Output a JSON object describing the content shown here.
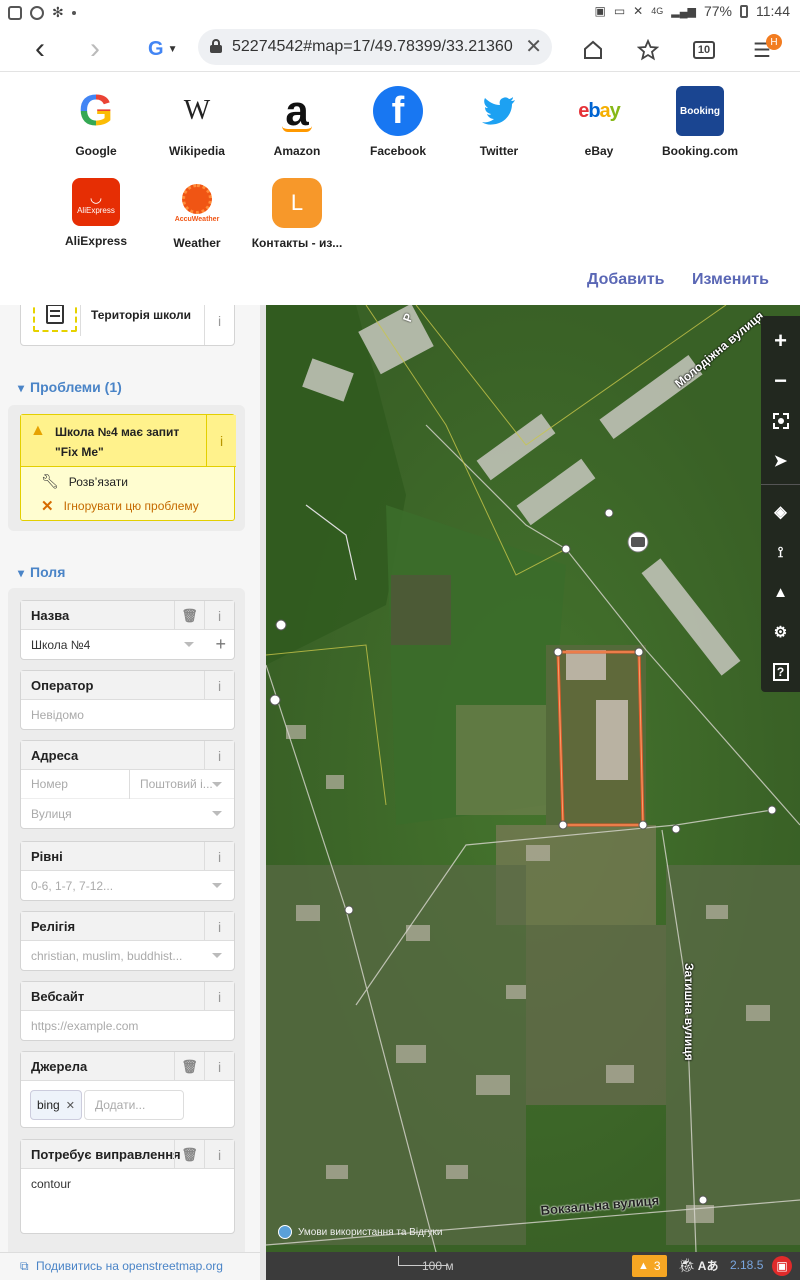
{
  "status_bar": {
    "battery": "77%",
    "time": "11:44",
    "network": "4G"
  },
  "browser": {
    "url": "52274542#map=17/49.78399/33.21360",
    "tab_count": "10",
    "menu_badge": "H"
  },
  "speed_dial": {
    "items": [
      {
        "label": "Google",
        "icon": "google-icon",
        "glyph": "G"
      },
      {
        "label": "Wikipedia",
        "icon": "wikipedia-icon",
        "glyph": "W"
      },
      {
        "label": "Amazon",
        "icon": "amazon-icon",
        "glyph": "a"
      },
      {
        "label": "Facebook",
        "icon": "facebook-icon",
        "glyph": "f"
      },
      {
        "label": "Twitter",
        "icon": "twitter-icon",
        "glyph": "🐦"
      },
      {
        "label": "eBay",
        "icon": "ebay-icon",
        "glyph": "ebay"
      },
      {
        "label": "Booking.com",
        "icon": "booking-icon",
        "glyph": "Booking"
      },
      {
        "label": "AliExpress",
        "icon": "aliexpress-icon",
        "glyph": "AliExpress"
      },
      {
        "label": "Weather",
        "icon": "weather-icon",
        "glyph": "AccuWeather"
      },
      {
        "label": "Контакты - из...",
        "icon": "contacts-icon",
        "glyph": "L"
      }
    ],
    "add_label": "Добавить",
    "edit_label": "Изменить"
  },
  "editor": {
    "preset_name": "Територія школи",
    "issues_title": "Проблеми (1)",
    "issue": {
      "message": "Школа №4 має запит \"Fix Me\"",
      "resolve": "Розв’язати",
      "ignore": "Ігнорувати цю проблему"
    },
    "fields_title": "Поля",
    "fields": {
      "name": {
        "label": "Назва",
        "value": "Школа №4"
      },
      "operator": {
        "label": "Оператор",
        "placeholder": "Невідомо"
      },
      "address": {
        "label": "Адреса",
        "number_placeholder": "Номер",
        "postcode_placeholder": "Поштовий і...",
        "street_placeholder": "Вулиця"
      },
      "levels": {
        "label": "Рівні",
        "placeholder": "0-6, 1-7, 7-12..."
      },
      "religion": {
        "label": "Релігія",
        "placeholder": "christian, muslim, buddhist..."
      },
      "website": {
        "label": "Вебсайт",
        "placeholder": "https://example.com"
      },
      "sources": {
        "label": "Джерела",
        "chip": "bing",
        "add_placeholder": "Додати..."
      },
      "fixme": {
        "label": "Потребує виправлення",
        "value": "contour"
      }
    },
    "view_on_osm": "Подивитись на openstreetmap.org"
  },
  "map": {
    "street_labels": [
      "Молодіжна вулиця",
      "Затишна вулиця",
      "Вокзальна вулиця",
      "Р"
    ],
    "scale": "100 м",
    "attribution": "Умови використання та Відгуки",
    "issue_count": "3",
    "version": "2.18.5"
  }
}
